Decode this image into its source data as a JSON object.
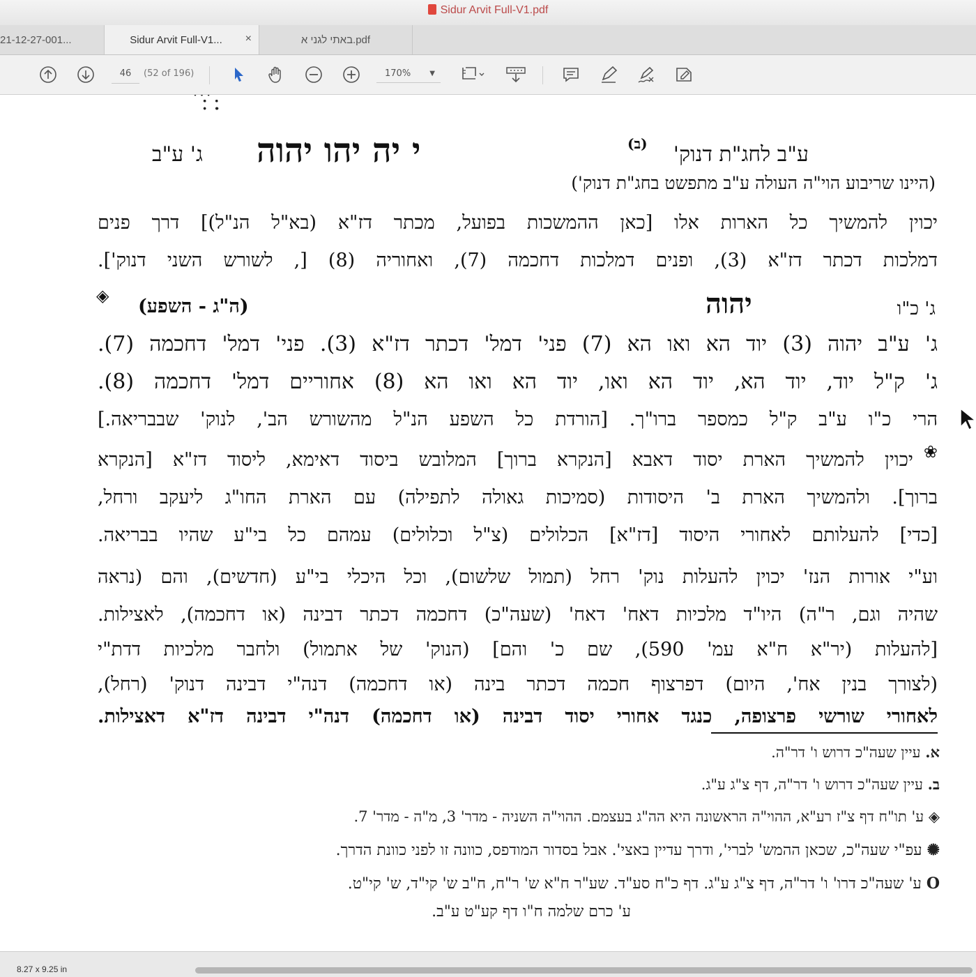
{
  "window": {
    "title": "Sidur Arvit Full-V1.pdf"
  },
  "tabs": [
    {
      "label": "21-12-27-001...",
      "active": false
    },
    {
      "label": "Sidur Arvit Full-V1...",
      "active": true,
      "close": "×"
    },
    {
      "label": "באתי לגני א.pdf",
      "active": false
    }
  ],
  "toolbar": {
    "page_input": "46",
    "page_count": "(52 of 196)",
    "zoom": "170%",
    "icons": [
      "scroll-up-icon",
      "scroll-down-icon",
      "select-arrow-icon",
      "hand-icon",
      "zoom-out-icon",
      "zoom-in-icon",
      "crop-icon",
      "insert-icon",
      "comment-icon",
      "pen-icon",
      "sign-icon",
      "markup-icon"
    ]
  },
  "document": {
    "top_fragment": "ׁ ׃ׄ׃ׄ׃  ׁ ׃ׄ׃ׁ׃ׁ.",
    "header": {
      "left_label": "ג' ע\"ב",
      "center_title": "י יה יהו יהוה",
      "right_label": "ע\"ב לחג\"ת דנוק'",
      "right_sup": "(ב)",
      "sub": "(היינו שריבוע הוי\"ה העולה ע\"ב מתפשט בחג\"ת דנוק')"
    },
    "para1": [
      "יכוין להמשיך כל הארות אלו [כאן ההמשכות בפועל, מכתר דז\"א (בא\"ל הנ\"ל)] דרך פנים",
      "דמלכות דכתר דז\"א (3), ופנים דמלכות דחכמה (7), ואחוריה (8) [, לשורש השני דנוק']."
    ],
    "line_gc": {
      "label": "ג' כ\"ו",
      "center": "יהוה",
      "left": "(ה\"ג - השפע)",
      "left_symbol": "◈"
    },
    "line_ab": "ג' ע\"ב  יהוה (3)  יוד הא ואו הא (7)  פני' דמל' דכתר דז\"א (3). פני' דמל' דחכמה (7).",
    "line_kl": "ג' ק\"ל  יוד, יוד הא, יוד הא ואו, יוד הא ואו הא (8)  אחוריים דמל' דחכמה (8).",
    "line_hari": "הרי כ\"ו ע\"ב ק\"ל כמספר ברו\"ך.   [הורדת כל השפע הנ\"ל מהשורש הב', לנוק' שבבריאה.]",
    "para2": [
      "יכוין להמשיך הארת יסוד דאבא [הנקרא ברוך] המלובש ביסוד דאימא, ליסוד דז\"א [הנקרא",
      "ברוך]. ולהמשיך הארת ב' היסודות (סמיכות גאולה לתפילה) עם הארת החו\"ג ליעקב ורחל,",
      "[כדי] להעלותם לאחורי היסוד [דז\"א] הכלולים (צ\"ל וכלולים) עמהם כל בי\"ע שהיו בבריאה."
    ],
    "para2_symbol": "❀",
    "para3": [
      "וע\"י אורות הנז' יכוין להעלות נוק' רחל (תמול שלשום), וכל היכלי בי\"ע (חדשים), והם (נראה",
      "שהיה וגם, ר\"ה) היו\"ד מלכיות דאח' דאח' (שעה\"כ) דחכמה דכתר דבינה (או דחכמה), לאצילות.",
      "[להעלות (יר\"א ח\"א עמ' 590), שם כ' והם] (הנוק' של אתמול) ולחבר מלכיות דדת\"י",
      "(לצורך בנין אח', היום) דפרצוף חכמה דכתר בינה (או דחכמה) דנה\"י דבינה דנוק' (רחל),",
      "לאחורי שורשי פרצופה, כנגד אחורי יסוד דבינה (או דחכמה) דנה\"י דבינה דז\"א דאצילות."
    ],
    "para3_symbol": "O",
    "footnotes": [
      {
        "mark": "א.",
        "text": "עיין שעה\"כ דרוש ו' דר\"ה."
      },
      {
        "mark": "ב.",
        "text": "עיין שעה\"כ דרוש ו' דר\"ה, דף צ\"ג ע\"ג."
      },
      {
        "mark": "◈",
        "text": "ע' תו\"ח דף צ\"ז רע\"א, ההוי\"ה הראשונה היא הה\"ג בעצמם. ההוי\"ה השניה - מדר' 3, מ\"ה - מדר' 7."
      },
      {
        "mark": "✺",
        "text": "עפ\"י שעה\"כ, שכאן ההמש' לברי', ודרך עדיין באצי'. אבל בסדור המודפס, כוונה זו לפני כוונת הדרך."
      },
      {
        "mark": "O",
        "text": "ע' שעה\"כ דרו' ו' דר\"ה, דף צ\"ג ע\"ג. דף כ\"ח סע\"ד. שע\"ר ח\"א ש' ר\"ח, ח\"ב ש' קי\"ד, ש' קי\"ט."
      },
      {
        "mark": "",
        "text": "ע' כרם שלמה ח\"ו דף קע\"ט ע\"ב."
      }
    ]
  },
  "status": {
    "page_size": "8.27 x 9.25 in"
  }
}
